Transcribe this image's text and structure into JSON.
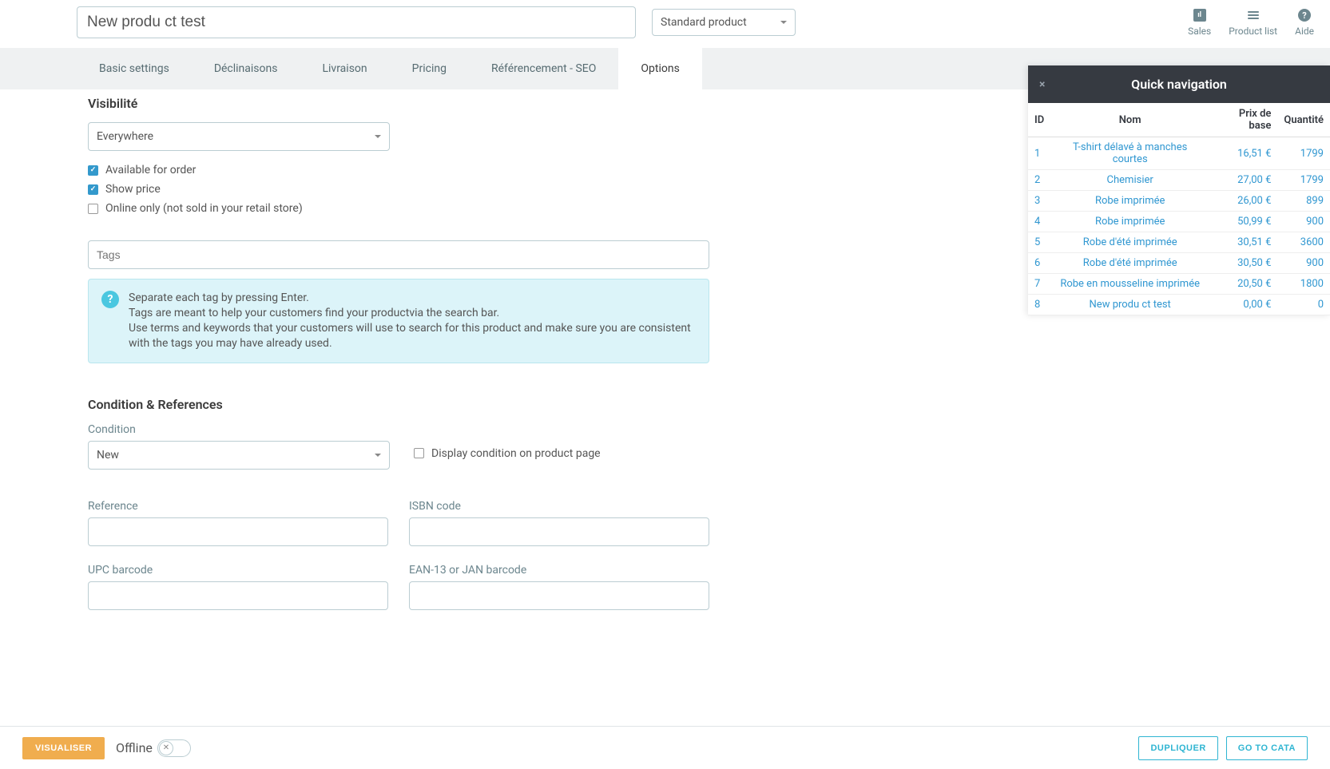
{
  "header": {
    "product_name": "New produ ct test",
    "product_type": "Standard product",
    "icons": {
      "sales": "Sales",
      "product_list": "Product list",
      "aide": "Aide"
    }
  },
  "tabs": [
    "Basic settings",
    "Déclinaisons",
    "Livraison",
    "Pricing",
    "Référencement - SEO",
    "Options"
  ],
  "active_tab": "Options",
  "options": {
    "visibility_title": "Visibilité",
    "visibility_value": "Everywhere",
    "available_for_order": "Available for order",
    "show_price": "Show price",
    "online_only": "Online only (not sold in your retail store)",
    "tags_placeholder": "Tags",
    "info_l1": "Separate each tag by pressing Enter.",
    "info_l2": "Tags are meant to help your customers find your productvia the search bar.",
    "info_l3": "Use terms and keywords that your customers will use to search for this product and make sure you are consistent with the tags you may have already used."
  },
  "condition": {
    "title": "Condition & References",
    "condition_label": "Condition",
    "condition_value": "New",
    "display_on_page": "Display condition on product page",
    "reference": "Reference",
    "isbn": "ISBN code",
    "upc": "UPC barcode",
    "ean": "EAN-13 or JAN barcode"
  },
  "quicknav": {
    "title": "Quick navigation",
    "columns": {
      "id": "ID",
      "nom": "Nom",
      "prix": "Prix de base",
      "quantite": "Quantité"
    },
    "rows": [
      {
        "id": "1",
        "nom": "T-shirt délavé à manches courtes",
        "prix": "16,51 €",
        "quantite": "1799"
      },
      {
        "id": "2",
        "nom": "Chemisier",
        "prix": "27,00 €",
        "quantite": "1799"
      },
      {
        "id": "3",
        "nom": "Robe imprimée",
        "prix": "26,00 €",
        "quantite": "899"
      },
      {
        "id": "4",
        "nom": "Robe imprimée",
        "prix": "50,99 €",
        "quantite": "900"
      },
      {
        "id": "5",
        "nom": "Robe d'été imprimée",
        "prix": "30,51 €",
        "quantite": "3600"
      },
      {
        "id": "6",
        "nom": "Robe d'été imprimée",
        "prix": "30,50 €",
        "quantite": "900"
      },
      {
        "id": "7",
        "nom": "Robe en mousseline imprimée",
        "prix": "20,50 €",
        "quantite": "1800"
      },
      {
        "id": "8",
        "nom": "New produ ct test",
        "prix": "0,00 €",
        "quantite": "0"
      }
    ]
  },
  "footer": {
    "visualiser": "VISUALISER",
    "status": "Offline",
    "dupliquer": "DUPLIQUER",
    "go_to_catalog": "GO TO CATA"
  }
}
